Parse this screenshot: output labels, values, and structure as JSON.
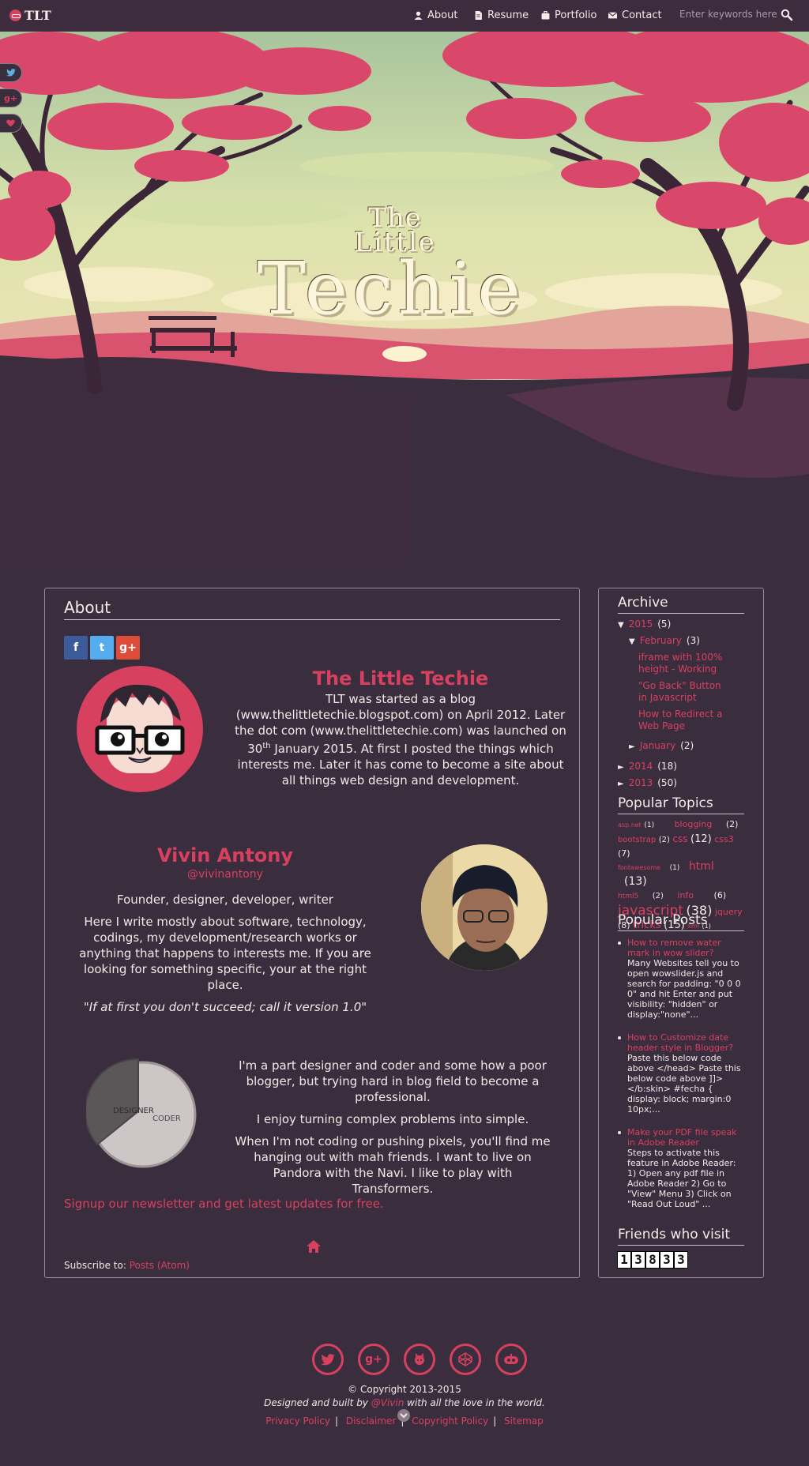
{
  "nav": {
    "logo": "TLT",
    "items": [
      {
        "label": "About",
        "icon": "person-icon"
      },
      {
        "label": "Resume",
        "icon": "document-icon"
      },
      {
        "label": "Portfolio",
        "icon": "briefcase-icon"
      },
      {
        "label": "Contact",
        "icon": "envelope-icon"
      }
    ],
    "search_placeholder": "Enter keywords here..."
  },
  "hero": {
    "line1": "The",
    "line2": "Little",
    "line3": "Techie"
  },
  "share_tabs": [
    "twitter-icon",
    "google-plus-icon",
    "heart-icon"
  ],
  "about": {
    "title": "About",
    "social": [
      "f",
      "t",
      "g+"
    ],
    "name": "The Little Techie",
    "text_before": "TLT was started as a blog (www.thelittletechie.blogspot.com) on April 2012. Later the dot com (www.thelittletechie.com) was launched on 30",
    "text_sup": "th",
    "text_after": " January 2015. At first I posted the things which interests me. Later it has come to become a site about all things web design and development.",
    "person": "Vivin Antony",
    "handle": "@vivinantony",
    "role": "Founder, designer, developer, writer",
    "bio": "Here I write mostly about software, technology, codings, my development/research works or anything that happens to interests me. If you are looking for something specific, your at the right place.",
    "quote": "\"If at first you don't succeed; call it version 1.0\"",
    "pie_labels": [
      "DESIGNER",
      "CODER"
    ],
    "p1": "I'm a part designer and coder and some how a poor blogger, but trying hard in blog field to become a professional.",
    "p2": "I enjoy turning complex problems into simple.",
    "p3": "When I'm not coding or pushing pixels, you'll find me hanging out with mah friends. I want to live on Pandora with the Navi. I like to play with Transformers.",
    "newsletter": "Signup our newsletter and get latest updates for free.",
    "subscribe_label": "Subscribe to:",
    "subscribe_link": "Posts (Atom)"
  },
  "archive": {
    "title": "Archive",
    "y2015": "2015",
    "y2015c": "(5)",
    "feb": "February",
    "febc": "(3)",
    "posts": [
      "iframe with 100% height - Working",
      "\"Go Back\" Button in Javascript",
      "How to Redirect a Web Page"
    ],
    "jan": "January",
    "janc": "(2)",
    "y2014": "2014",
    "y2014c": "(18)",
    "y2013": "2013",
    "y2013c": "(50)"
  },
  "topics": {
    "title": "Popular Topics",
    "list": [
      {
        "t": "asp.net",
        "c": "(1)",
        "s": 8
      },
      {
        "t": "blogging",
        "c": "(2)",
        "s": 11
      },
      {
        "t": "bootstrap",
        "c": "(2)",
        "s": 10
      },
      {
        "t": "css",
        "c": "(12)",
        "s": 12
      },
      {
        "t": "css3",
        "c": "(7)",
        "s": 11
      },
      {
        "t": "fontawesome",
        "c": "(1)",
        "s": 8
      },
      {
        "t": "html",
        "c": "(13)",
        "s": 14
      },
      {
        "t": "html5",
        "c": "(2)",
        "s": 9
      },
      {
        "t": "info",
        "c": "(6)",
        "s": 11
      },
      {
        "t": "javascript",
        "c": "(38)",
        "s": 17
      },
      {
        "t": "jquery",
        "c": "(8)",
        "s": 11
      },
      {
        "t": "tricks",
        "c": "(15)",
        "s": 13
      },
      {
        "t": "xml",
        "c": "(1)",
        "s": 8
      }
    ]
  },
  "popular": {
    "title": "Popular Posts",
    "posts": [
      {
        "title": "How to remove water mark in wow slider?",
        "body": "Many Websites tell you to open wowslider.js and search for padding: \"0 0 0 0\" and hit Enter and put visibility: \"hidden\" or display:\"none\"..."
      },
      {
        "title": "How to Customize date header style in Blogger?",
        "body": "Paste this below code above </head> Paste this below code above ]]></b:skin> #fecha { display: block; margin:0 10px;..."
      },
      {
        "title": "Make your PDF file speak in Adobe Reader",
        "body": "Steps to activate this feature in Adobe Reader: 1) Open any pdf file in Adobe Reader 2) Go to \"View\" Menu 3) Click on \"Read Out Loud\" ..."
      }
    ]
  },
  "friends": {
    "title": "Friends who visit",
    "count": "13833"
  },
  "footer": {
    "icons": [
      "twitter-icon",
      "google-plus-icon",
      "github-icon",
      "codepen-icon",
      "dribbble-icon"
    ],
    "copyright": "© Copyright 2013-2015",
    "designed_pre": "Designed and built by ",
    "designed_link": "@Vivin",
    "designed_post": " with all the love in the world.",
    "links": [
      "Privacy Policy",
      "Disclaimer",
      "Copyright Policy",
      "Sitemap"
    ]
  },
  "colors": {
    "accent": "#d8405f",
    "background": "#3a2e3e"
  }
}
